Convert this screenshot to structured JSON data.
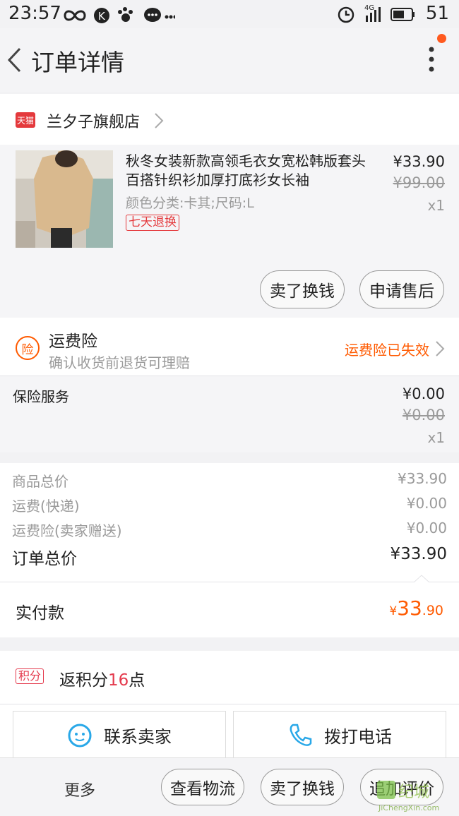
{
  "status_bar": {
    "time": "23:57",
    "network": "4G",
    "battery": "51"
  },
  "nav": {
    "title": "订单详情"
  },
  "shop": {
    "badge": "天猫",
    "name": "兰夕子旗舰店"
  },
  "product": {
    "title": "秋冬女装新款高领毛衣女宽松韩版套头百搭针织衫加厚打底衫女长袖",
    "sku": "颜色分类:卡其;尺码:L",
    "tag": "七天退换",
    "price": "¥33.90",
    "orig_price": "¥99.00",
    "qty": "x1",
    "actions": [
      "卖了换钱",
      "申请售后"
    ]
  },
  "insurance": {
    "icon_char": "险",
    "title": "运费险",
    "subtitle": "确认收货前退货可理赔",
    "status": "运费险已失效"
  },
  "service": {
    "label": "保险服务",
    "price": "¥0.00",
    "orig_price": "¥0.00",
    "qty": "x1"
  },
  "summary": {
    "rows": [
      {
        "label": "商品总价",
        "value": "¥33.90"
      },
      {
        "label": "运费(快递)",
        "value": "¥0.00"
      },
      {
        "label": "运费险(卖家赠送)",
        "value": "¥0.00"
      }
    ],
    "total_label": "订单总价",
    "total_value": "¥33.90"
  },
  "paid": {
    "label": "实付款",
    "currency": "¥",
    "int": "33",
    "dec": ".90"
  },
  "points": {
    "badge": "积分",
    "prefix": "返积分",
    "count": "16",
    "suffix": "点"
  },
  "contact": {
    "seller": "联系卖家",
    "call": "拨打电话"
  },
  "bottom": {
    "more": "更多",
    "buttons": [
      "查看物流",
      "卖了换钱",
      "追加评价"
    ]
  },
  "watermark": {
    "text": "JiChengXin.com",
    "logo": "纪城"
  },
  "colors": {
    "accent": "#ff5a00",
    "tmall_red": "#e4393c",
    "points_red": "#e4394c"
  }
}
